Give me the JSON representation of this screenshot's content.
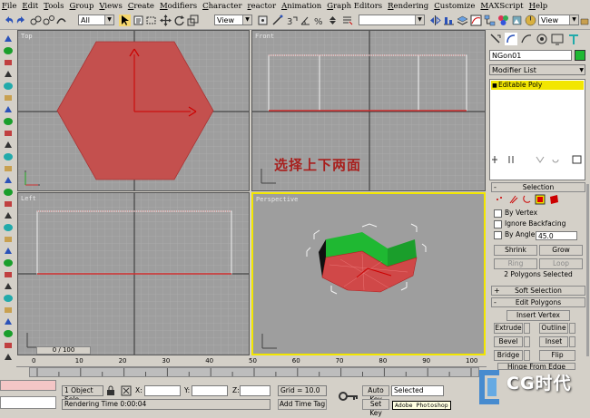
{
  "menu": [
    "File",
    "Edit",
    "Tools",
    "Group",
    "Views",
    "Create",
    "Modifiers",
    "Character",
    "reactor",
    "Animation",
    "Graph Editors",
    "Rendering",
    "Customize",
    "MAXScript",
    "Help"
  ],
  "toolbar": {
    "selection_filter": "All",
    "ref_coord": "View",
    "view_right": "View"
  },
  "viewports": {
    "top": "Top",
    "front": "Front",
    "left": "Left",
    "perspective": "Perspective"
  },
  "annotation": "选择上下两面",
  "command_panel": {
    "object_name": "NGon01",
    "modifier_list": "Modifier List",
    "stack_item": "Editable Poly",
    "selection_rollout": "Selection",
    "by_vertex": "By Vertex",
    "ignore_backfacing": "Ignore Backfacing",
    "by_angle": "By Angle:",
    "angle_value": "45.0",
    "shrink": "Shrink",
    "grow": "Grow",
    "ring": "Ring",
    "loop": "Loop",
    "selection_status": "2 Polygons Selected",
    "soft_selection": "Soft Selection",
    "edit_polygons": "Edit Polygons",
    "insert_vertex": "Insert Vertex",
    "extrude": "Extrude",
    "outline": "Outline",
    "bevel": "Bevel",
    "inset": "Inset",
    "bridge": "Bridge",
    "flip": "Flip",
    "hinge_from_edge": "Hinge From Edge"
  },
  "timeline": {
    "frame_counter": "0 / 100",
    "ticks": [
      "0",
      "10",
      "20",
      "30",
      "40",
      "50",
      "60",
      "70",
      "80",
      "90",
      "100"
    ]
  },
  "status": {
    "object_sel": "1 Object Sele",
    "x_label": "X:",
    "y_label": "Y:",
    "z_label": "Z:",
    "grid": "Grid = 10.0",
    "auto_key": "Auto Key",
    "selected": "Selected",
    "rendering_time": "Rendering Time  0:00:04",
    "add_time_tag": "Add Time Tag",
    "set_key": "Set Key",
    "tooltip": "Adobe Photoshop"
  },
  "watermark": "CG时代",
  "colors": {
    "poly_red": "#c4504e",
    "selection_red": "#d03030",
    "active_border": "#f2e600",
    "green_face": "#1fb832"
  }
}
